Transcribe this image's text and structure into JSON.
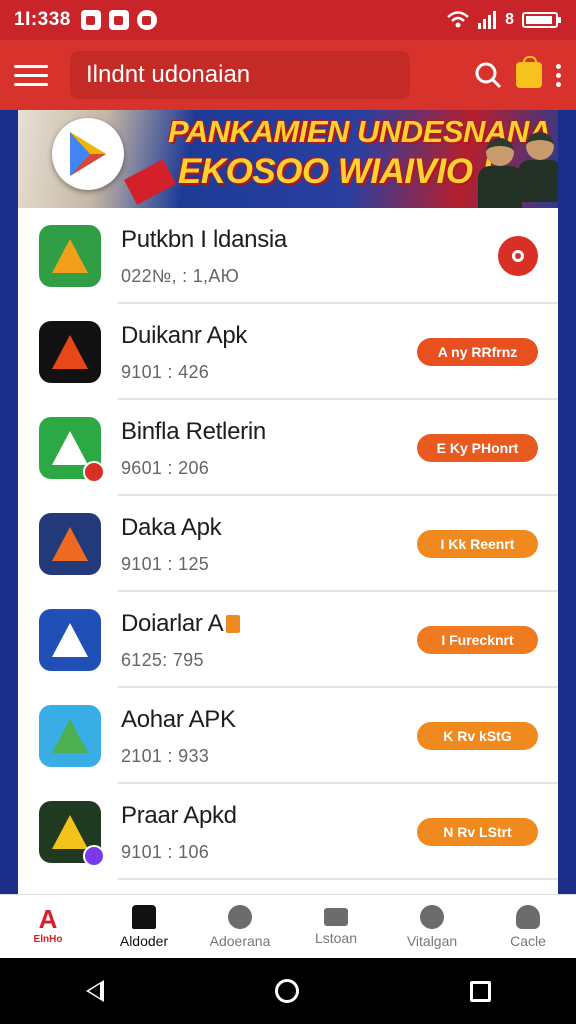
{
  "status_bar": {
    "time": "1Ӏ:338",
    "battery_text": "8"
  },
  "app_bar": {
    "search_text": "Ilndnt udonaian"
  },
  "banner": {
    "line1": "PANKAMIEN UNDESNANA",
    "line2": "EKOSOO WIAIVIO I"
  },
  "apps": [
    {
      "name": "Putkbn I ldansia",
      "meta": "022№, : 1,AЮ",
      "action": "",
      "icon_color": "#2f9e44",
      "accent": "#f2a01b",
      "badge_color": ""
    },
    {
      "name": "Duikanr Apk",
      "meta": "9101 : 426",
      "action": "A ny RRfrnz",
      "icon_color": "#111111",
      "accent": "#e8471a",
      "badge_color": ""
    },
    {
      "name": "Binfla Retlerin",
      "meta": "9601 : 206",
      "action": "Е Ky PHonrt",
      "icon_color": "#2ca845",
      "accent": "#ffffff",
      "badge_color": "#d93025"
    },
    {
      "name": "Daka Apk",
      "meta": "9101 : 125",
      "action": "I Kk Reenrt",
      "icon_color": "#22397a",
      "accent": "#ee6a22",
      "badge_color": ""
    },
    {
      "name": "Doiarlar A",
      "meta": "6125: 795",
      "action": "I Furecknrt",
      "icon_color": "#2050b5",
      "accent": "#ffffff",
      "badge_color": ""
    },
    {
      "name": "Aohar APK",
      "meta": "2101 : 933",
      "action": "K Rv kStG",
      "icon_color": "#39aee6",
      "accent": "#4caf50",
      "badge_color": ""
    },
    {
      "name": "Praar Apkd",
      "meta": "9101 : 106",
      "action": "N Rv LStrt",
      "icon_color": "#1f3a20",
      "accent": "#f3c31b",
      "badge_color": "#7c3aed"
    }
  ],
  "pill_colors": [
    "#e8511f",
    "#e85a1f",
    "#f08a1f",
    "#f07a1f",
    "#f08a1f",
    "#f08a1f"
  ],
  "bottom_nav": [
    {
      "label": "ElnHo",
      "icon": "app-logo"
    },
    {
      "label": "Aldoder",
      "icon": "house-icon"
    },
    {
      "label": "Adoerana",
      "icon": "chat-icon"
    },
    {
      "label": "Lstoan",
      "icon": "mail-icon"
    },
    {
      "label": "Vitalgan",
      "icon": "games-icon"
    },
    {
      "label": "Cacle",
      "icon": "person-icon"
    }
  ]
}
